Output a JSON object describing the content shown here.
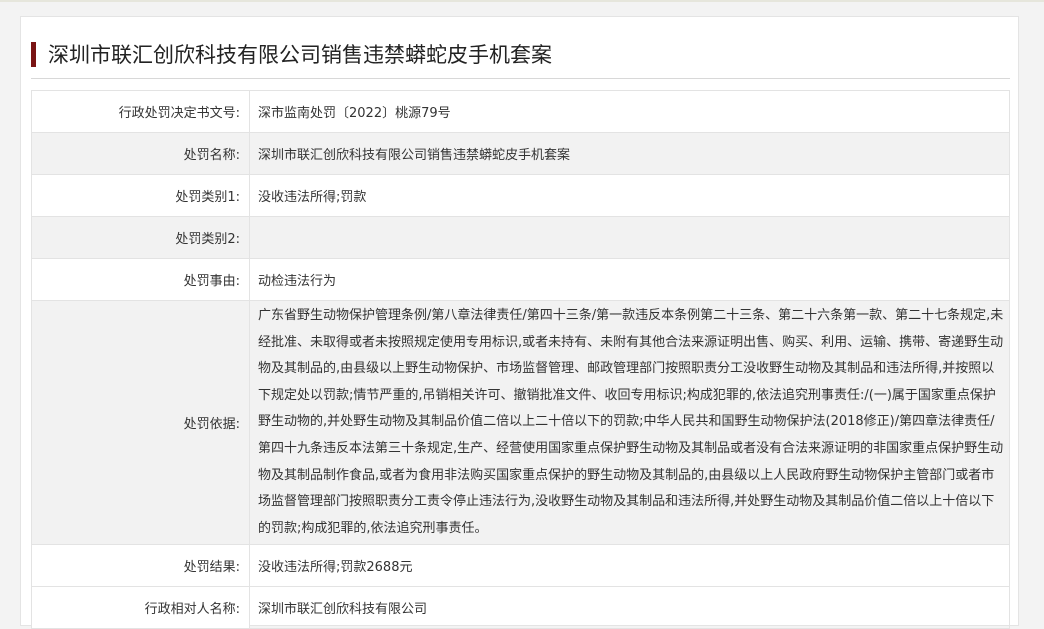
{
  "page": {
    "title": "深圳市联汇创欣科技有限公司销售违禁蟒蛇皮手机套案"
  },
  "rows": [
    {
      "label": "行政处罚决定书文号:",
      "value": "深市监南处罚〔2022〕桃源79号"
    },
    {
      "label": "处罚名称:",
      "value": "深圳市联汇创欣科技有限公司销售违禁蟒蛇皮手机套案"
    },
    {
      "label": "处罚类别1:",
      "value": "没收违法所得;罚款"
    },
    {
      "label": "处罚类别2:",
      "value": ""
    },
    {
      "label": "处罚事由:",
      "value": "动检违法行为"
    },
    {
      "label": "处罚依据:",
      "value": "广东省野生动物保护管理条例/第八章法律责任/第四十三条/第一款违反本条例第二十三条、第二十六条第一款、第二十七条规定,未经批准、未取得或者未按照规定使用专用标识,或者未持有、未附有其他合法来源证明出售、购买、利用、运输、携带、寄递野生动物及其制品的,由县级以上野生动物保护、市场监督管理、邮政管理部门按照职责分工没收野生动物及其制品和违法所得,并按照以下规定处以罚款;情节严重的,吊销相关许可、撤销批准文件、收回专用标识;构成犯罪的,依法追究刑事责任:/(一)属于国家重点保护野生动物的,并处野生动物及其制品价值二倍以上二十倍以下的罚款;中华人民共和国野生动物保护法(2018修正)/第四章法律责任/第四十九条违反本法第三十条规定,生产、经营使用国家重点保护野生动物及其制品或者没有合法来源证明的非国家重点保护野生动物及其制品制作食品,或者为食用非法购买国家重点保护的野生动物及其制品的,由县级以上人民政府野生动物保护主管部门或者市场监督管理部门按照职责分工责令停止违法行为,没收野生动物及其制品和违法所得,并处野生动物及其制品价值二倍以上十倍以下的罚款;构成犯罪的,依法追究刑事责任。"
    },
    {
      "label": "处罚结果:",
      "value": "没收违法所得;罚款2688元"
    },
    {
      "label": "行政相对人名称:",
      "value": "深圳市联汇创欣科技有限公司"
    }
  ],
  "colors": {
    "accent": "#7a1414",
    "row_alt": "#f2f2f2",
    "border": "#e3e3e3"
  }
}
